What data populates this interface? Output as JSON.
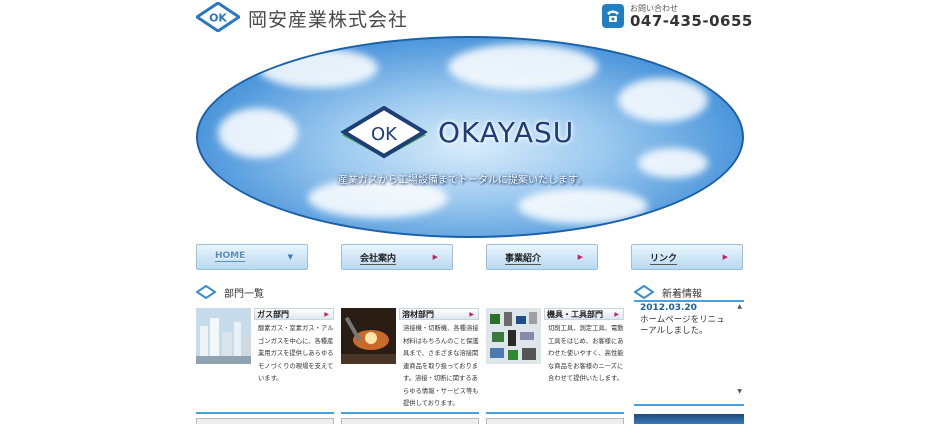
{
  "header": {
    "logo_text": "OK",
    "company_name": "岡安産業株式会社",
    "phone_caption": "お問い合わせ",
    "phone_number": "047-435-0655"
  },
  "hero": {
    "logo_text": "OK",
    "brand": "OKAYASU",
    "tagline": "産業ガスから工場設備までトータルに提案いたします。"
  },
  "nav": {
    "items": [
      {
        "label": "HOME",
        "active": true
      },
      {
        "label": "会社案内",
        "active": false
      },
      {
        "label": "事業紹介",
        "active": false
      },
      {
        "label": "リンク",
        "active": false
      }
    ]
  },
  "departments": {
    "title": "部門一覧",
    "cards": [
      {
        "name": "ガス部門",
        "description": "酸素ガス・窒素ガス・アルゴンガスを中心に、各種産業用ガスを提供しあらゆるモノづくりの現場を支えています。"
      },
      {
        "name": "溶材部門",
        "description": "溶接機・切断機、各種溶接材料はもちろんのこと保護具まで、さまざまな溶接関連商品を取り扱っております。溶接・切断に関するあらゆる情報・サービス等も提供しております。"
      },
      {
        "name": "機具・工具部門",
        "description": "切削工具、測定工具、電動工具をはじめ、お客様にあわせた使いやすく、高性能な商品をお客様のニーズに合わせて提供いたします。"
      }
    ]
  },
  "news": {
    "title": "新着情報",
    "date": "2012.03.20",
    "body": "ホームページをリニューアルしました。"
  }
}
